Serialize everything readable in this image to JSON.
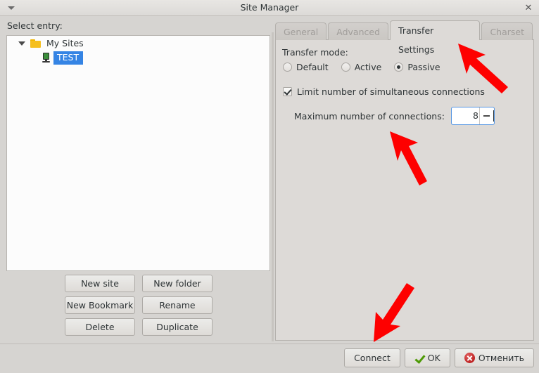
{
  "window": {
    "title": "Site Manager",
    "menu_icon": "chevron-down-icon",
    "close_icon": "close-icon"
  },
  "left_pane": {
    "label": "Select entry:",
    "tree": [
      {
        "label": "My Sites",
        "icon": "folder-icon",
        "level": 0,
        "expanded": true,
        "selected": false
      },
      {
        "label": "TEST",
        "icon": "server-icon",
        "level": 1,
        "expanded": false,
        "selected": true
      }
    ],
    "buttons": [
      {
        "label": "New site"
      },
      {
        "label": "New folder"
      },
      {
        "label": "New Bookmark"
      },
      {
        "label": "Rename"
      },
      {
        "label": "Delete"
      },
      {
        "label": "Duplicate"
      }
    ]
  },
  "notebook": {
    "tabs": [
      {
        "label": "General",
        "active": false
      },
      {
        "label": "Advanced",
        "active": false
      },
      {
        "label": "Transfer Settings",
        "active": true
      },
      {
        "label": "Charset",
        "active": false
      }
    ]
  },
  "transfer_settings": {
    "group_label": "Transfer mode:",
    "modes": [
      {
        "label": "Default",
        "selected": false
      },
      {
        "label": "Active",
        "selected": false
      },
      {
        "label": "Passive",
        "selected": true
      }
    ],
    "limit_checkbox": {
      "label": "Limit number of simultaneous connections",
      "checked": true
    },
    "max_connections": {
      "label": "Maximum number of connections:",
      "value": "8"
    }
  },
  "actions": [
    {
      "label": "Connect",
      "icon": null
    },
    {
      "label": "OK",
      "icon": "check-icon"
    },
    {
      "label": "Отменить",
      "icon": "cancel-icon"
    }
  ],
  "annotations": {
    "arrow_color": "#fe0000",
    "arrows": [
      {
        "name": "arrow-to-transfer-settings-tab",
        "points_to": "Transfer Settings tab"
      },
      {
        "name": "arrow-to-max-connections",
        "points_to": "Maximum number of connections spinner"
      },
      {
        "name": "arrow-to-connect-button",
        "points_to": "Connect button"
      }
    ]
  },
  "colors": {
    "accent": "#3584e4",
    "focus_border": "#5294e2",
    "window_bg": "#d6d4d1",
    "panel_bg": "#dddad7",
    "tree_bg": "#fcfcfc"
  }
}
